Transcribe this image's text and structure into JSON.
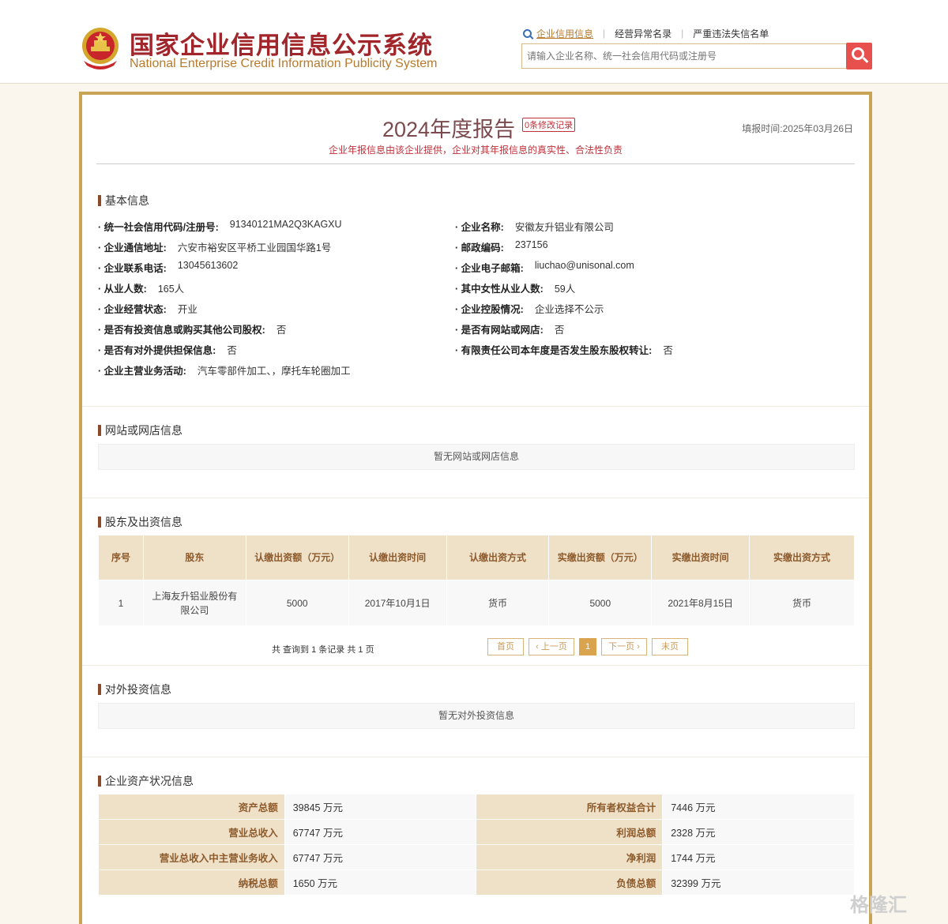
{
  "header": {
    "logo_cn": "国家企业信用信息公示系统",
    "logo_en": "National Enterprise Credit Information Publicity System",
    "nav": [
      "企业信用信息",
      "经营异常名录",
      "严重违法失信名单"
    ],
    "search_placeholder": "请输入企业名称、统一社会信用代码或注册号"
  },
  "report": {
    "title": "2024年度报告",
    "modify_badge": "0条修改记录",
    "subtitle": "企业年报信息由该企业提供，企业对其年报信息的真实性、合法性负责",
    "fill_date": "填报时间:2025年03月26日"
  },
  "basic": {
    "heading": "基本信息",
    "left": [
      {
        "label": "统一社会信用代码/注册号:",
        "value": "91340121MA2Q3KAGXU"
      },
      {
        "label": "企业通信地址:",
        "value": "六安市裕安区平桥工业园国华路1号"
      },
      {
        "label": "企业联系电话:",
        "value": "13045613602"
      },
      {
        "label": "从业人数:",
        "value": "165人"
      },
      {
        "label": "企业经营状态:",
        "value": "开业"
      },
      {
        "label": "是否有投资信息或购买其他公司股权:",
        "value": "否"
      },
      {
        "label": "是否有对外提供担保信息:",
        "value": "否"
      },
      {
        "label": "企业主营业务活动:",
        "value": "汽车零部件加工、，摩托车轮圈加工"
      }
    ],
    "right": [
      {
        "label": "企业名称:",
        "value": "安徽友升铝业有限公司"
      },
      {
        "label": "邮政编码:",
        "value": "237156"
      },
      {
        "label": "企业电子邮箱:",
        "value": "liuchao@unisonal.com"
      },
      {
        "label": "其中女性从业人数:",
        "value": "59人"
      },
      {
        "label": "企业控股情况:",
        "value": "企业选择不公示"
      },
      {
        "label": "是否有网站或网店:",
        "value": "否"
      },
      {
        "label": "有限责任公司本年度是否发生股东股权转让:",
        "value": "否"
      }
    ]
  },
  "website": {
    "heading": "网站或网店信息",
    "empty": "暂无网站或网店信息"
  },
  "shareholders": {
    "heading": "股东及出资信息",
    "columns": [
      "序号",
      "股东",
      "认缴出资额（万元）",
      "认缴出资时间",
      "认缴出资方式",
      "实缴出资额（万元）",
      "实缴出资时间",
      "实缴出资方式"
    ],
    "rows": [
      [
        "1",
        "上海友升铝业股份有限公司",
        "5000",
        "2017年10月1日",
        "货币",
        "5000",
        "2021年8月15日",
        "货币"
      ]
    ],
    "pager_info": "共 查询到 1 条记录 共 1 页",
    "pager": {
      "first": "首页",
      "prev": "上一页",
      "current": "1",
      "next": "下一页",
      "last": "末页"
    }
  },
  "investment": {
    "heading": "对外投资信息",
    "empty": "暂无对外投资信息"
  },
  "assets": {
    "heading": "企业资产状况信息",
    "rows": [
      [
        {
          "k": "资产总额",
          "v": "39845 万元"
        },
        {
          "k": "所有者权益合计",
          "v": "7446 万元"
        }
      ],
      [
        {
          "k": "营业总收入",
          "v": "67747 万元"
        },
        {
          "k": "利润总额",
          "v": "2328 万元"
        }
      ],
      [
        {
          "k": "营业总收入中主营业务收入",
          "v": "67747 万元"
        },
        {
          "k": "净利润",
          "v": "1744 万元"
        }
      ],
      [
        {
          "k": "纳税总额",
          "v": "1650 万元"
        },
        {
          "k": "负债总额",
          "v": "32399 万元"
        }
      ]
    ]
  },
  "watermark": "格隆汇",
  "colors": {
    "accent": "#c8a457",
    "brand_red": "#a0262b",
    "search_btn": "#e8504e"
  }
}
